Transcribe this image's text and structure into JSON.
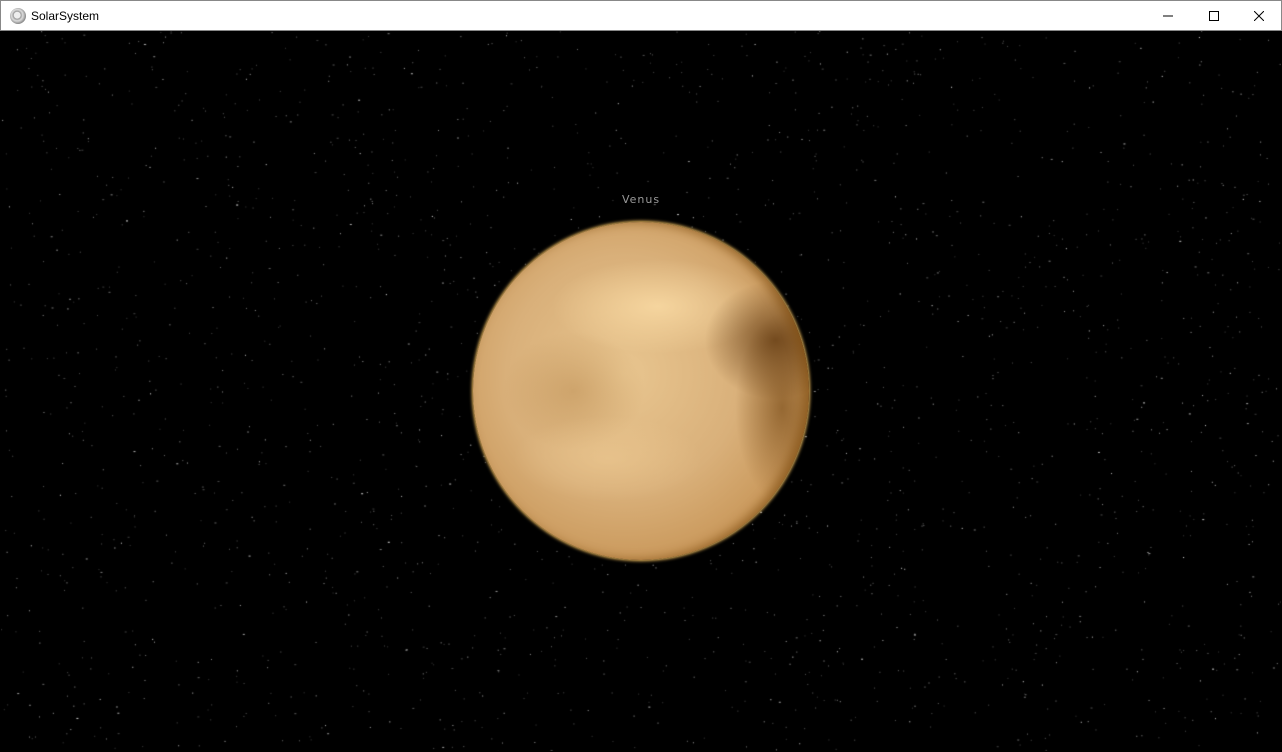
{
  "window": {
    "title": "SolarSystem",
    "icon": "solar-system-logo-icon",
    "controls": {
      "minimize": "minimize-icon",
      "maximize": "maximize-icon",
      "close": "close-icon"
    }
  },
  "scene": {
    "planet_label": "Venus",
    "colors": {
      "background": "#000000",
      "planet": "#d9b07a",
      "rim": "#f4c060",
      "label": "#9a9a9a"
    }
  }
}
